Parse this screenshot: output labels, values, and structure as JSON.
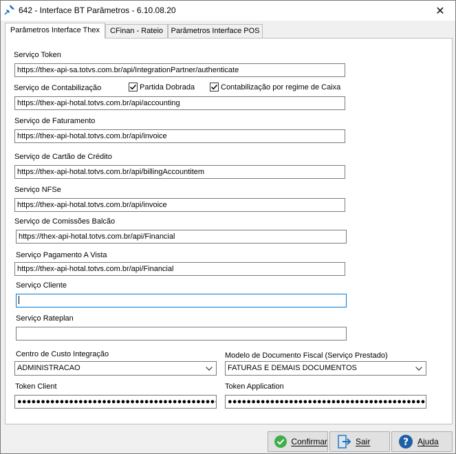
{
  "window": {
    "title": "642 - Interface BT Parâmetros - 6.10.08.20",
    "close_glyph": "✕"
  },
  "tabs": [
    {
      "label": "Parâmetros Interface Thex",
      "active": true
    },
    {
      "label": "CFinan - Rateio",
      "active": false
    },
    {
      "label": "Parâmetros Interface POS",
      "active": false
    }
  ],
  "form": {
    "token_label": "Serviço Token",
    "token_value": "https://thex-api-sa.totvs.com.br/api/IntegrationPartner/authenticate",
    "contab_label": "Serviço de Contabilização",
    "partida_label": "Partida Dobrada",
    "partida_checked": true,
    "regime_label": "Contabilização por regime de Caixa",
    "regime_checked": true,
    "contab_value": "https://thex-api-hotal.totvs.com.br/api/accounting",
    "fatur_label": "Serviço de Faturamento",
    "fatur_value": "https://thex-api-hotal.totvs.com.br/api/invoice",
    "cartao_label": "Serviço de Cartão de Crédito",
    "cartao_value": "https://thex-api-hotal.totvs.com.br/api/billingAccountitem",
    "nfse_label": "Serviço NFSe",
    "nfse_value": "https://thex-api-hotal.totvs.com.br/api/invoice",
    "comiss_label": "Serviço de Comissões Balcão",
    "comiss_value": "https://thex-api-hotal.totvs.com.br/api/Financial",
    "pagto_label": "Serviço Pagamento A Vista",
    "pagto_value": "https://thex-api-hotal.totvs.com.br/api/Financial",
    "cliente_label": "Serviço Cliente",
    "cliente_value": "",
    "rateplan_label": "Serviço Rateplan",
    "rateplan_value": "",
    "centro_label": "Centro de Custo Integração",
    "centro_value": "ADMINISTRACAO",
    "modelo_label": "Modelo de Documento Fiscal (Serviço Prestado)",
    "modelo_value": "FATURAS E DEMAIS DOCUMENTOS",
    "token_client_label": "Token Client",
    "token_client_value": "●●●●●●●●●●●●●●●●●●●●●●●●●●●●●●●●●●●●●●●●●●●●●●●●●●●●",
    "token_app_label": "Token Application",
    "token_app_value": "●●●●●●●●●●●●●●●●●●●●●●●●●●●●●●●●●●●●●●●●●●●●●●●●●●●●"
  },
  "buttons": {
    "confirm_label": "Confirmar",
    "exit_label": "Sair",
    "help_label": "Ajuda"
  },
  "colors": {
    "confirm_icon": "#3fae49",
    "help_icon": "#1f5fa8",
    "exit_icon": "#1f6fb6",
    "pin_icon": "#1e73be"
  }
}
